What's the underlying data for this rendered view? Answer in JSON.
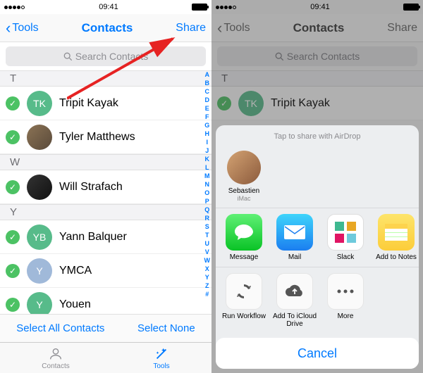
{
  "status": {
    "time": "09:41"
  },
  "nav": {
    "back": "Tools",
    "title": "Contacts",
    "share": "Share"
  },
  "search": {
    "placeholder": "Search Contacts"
  },
  "sections": {
    "t": "T",
    "w": "W",
    "y": "Y"
  },
  "contacts": {
    "tripit": {
      "name": "Tripit Kayak",
      "initials": "TK"
    },
    "tyler": {
      "name": "Tyler Matthews"
    },
    "will": {
      "name": "Will Strafach"
    },
    "yann": {
      "name": "Yann Balquer",
      "initials": "YB"
    },
    "ymca": {
      "name": "YMCA",
      "initials": "Y"
    },
    "youen": {
      "name": "Youen",
      "initials": "Y"
    }
  },
  "index": [
    "A",
    "B",
    "C",
    "D",
    "E",
    "F",
    "G",
    "H",
    "I",
    "J",
    "K",
    "L",
    "M",
    "N",
    "O",
    "P",
    "Q",
    "R",
    "S",
    "T",
    "U",
    "V",
    "W",
    "X",
    "Y",
    "Z",
    "#"
  ],
  "bottom": {
    "selectAll": "Select All Contacts",
    "selectNone": "Select None"
  },
  "tabs": {
    "contacts": "Contacts",
    "tools": "Tools"
  },
  "sheet": {
    "title": "Tap to share with AirDrop",
    "airdrop": {
      "name": "Sebastien",
      "device": "iMac"
    },
    "apps": {
      "message": "Message",
      "mail": "Mail",
      "slack": "Slack",
      "notes": "Add to Notes"
    },
    "actions": {
      "workflow": "Run Workflow",
      "icloud": "Add To iCloud Drive",
      "more": "More"
    },
    "cancel": "Cancel"
  }
}
